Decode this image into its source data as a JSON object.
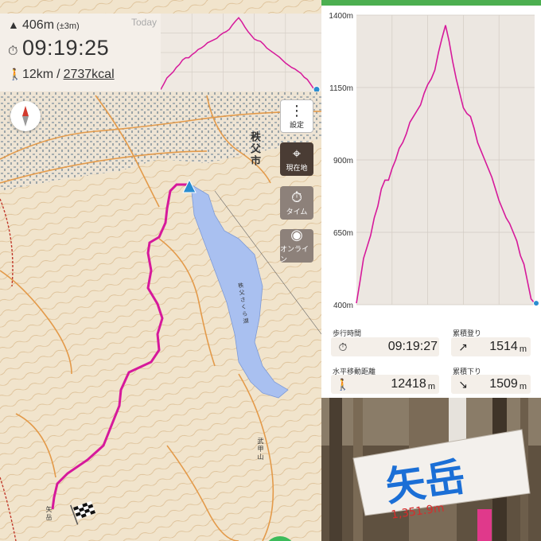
{
  "header": {
    "altitude": "406m",
    "altitude_accuracy": "(±3m)",
    "elapsed_time": "09:19:25",
    "distance": "12km",
    "separator": "/",
    "calories": "2737kcal",
    "today_label": "Today"
  },
  "map": {
    "city_label": "秩父市",
    "lake_label": "秩父さくら湖",
    "peak_label": "矢岳",
    "mountain_label": "武甲山"
  },
  "controls": {
    "settings_label": "設定",
    "location_label": "現在地",
    "timer_label": "タイム",
    "online_label": "オンライン"
  },
  "chart_data": {
    "type": "line",
    "ylim": [
      400,
      1400
    ],
    "y_ticks": [
      "1400m",
      "1150m",
      "900m",
      "650m",
      "400m"
    ],
    "y_tick_values": [
      1400,
      1150,
      900,
      650,
      400
    ],
    "x": [
      0,
      0.02,
      0.04,
      0.06,
      0.08,
      0.1,
      0.12,
      0.14,
      0.16,
      0.18,
      0.2,
      0.22,
      0.24,
      0.26,
      0.28,
      0.3,
      0.32,
      0.34,
      0.36,
      0.38,
      0.4,
      0.42,
      0.44,
      0.46,
      0.48,
      0.5,
      0.52,
      0.54,
      0.56,
      0.58,
      0.6,
      0.62,
      0.64,
      0.66,
      0.68,
      0.7,
      0.72,
      0.74,
      0.76,
      0.78,
      0.8,
      0.82,
      0.84,
      0.86,
      0.88,
      0.9,
      0.92,
      0.94,
      0.96,
      0.98,
      1.0
    ],
    "series": [
      {
        "color": "#d6199b",
        "values": [
          405,
          480,
          560,
          600,
          640,
          700,
          740,
          800,
          830,
          830,
          870,
          900,
          940,
          960,
          990,
          1030,
          1050,
          1070,
          1090,
          1130,
          1160,
          1180,
          1210,
          1270,
          1320,
          1365,
          1310,
          1240,
          1180,
          1130,
          1080,
          1060,
          1050,
          1010,
          960,
          930,
          900,
          870,
          840,
          800,
          760,
          730,
          700,
          680,
          650,
          620,
          570,
          540,
          480,
          420,
          405
        ]
      }
    ]
  },
  "stats": {
    "walking_time_label": "歩行時間",
    "walking_time": "09:19:27",
    "ascent_label": "累積登り",
    "ascent": "1514",
    "ascent_unit": "m",
    "distance_label": "水平移動距離",
    "distance": "12418",
    "distance_unit": "m",
    "descent_label": "累積下り",
    "descent": "1509",
    "descent_unit": "m"
  },
  "photo": {
    "sign_text": "矢岳",
    "sign_elevation": "1,351.9m"
  },
  "colors": {
    "route": "#d6199b",
    "accent_green": "#4caf50",
    "lake": "#9fb8ef",
    "panel_bg": "#f4efe9"
  }
}
